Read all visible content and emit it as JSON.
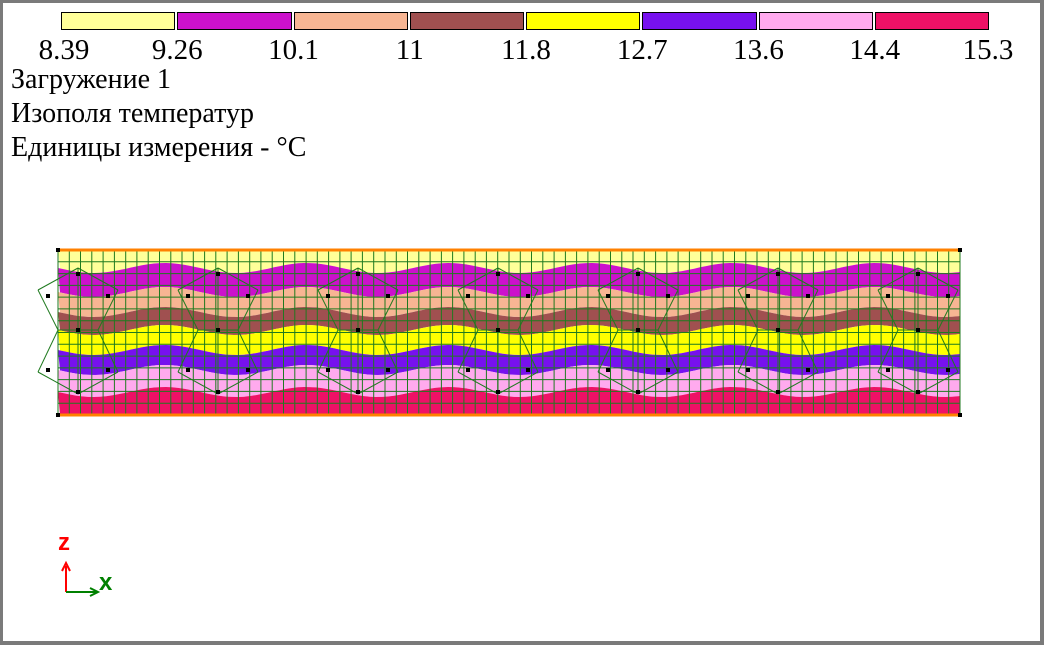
{
  "chart_data": {
    "type": "heatmap",
    "legend": {
      "colors": [
        "#ffff99",
        "#cc11cc",
        "#f7b593",
        "#a05050",
        "#ffff00",
        "#7711ee",
        "#ffaaee",
        "#ee1166"
      ],
      "ticks": [
        "8.39",
        "9.26",
        "10.1",
        "11",
        "11.8",
        "12.7",
        "13.6",
        "14.4",
        "15.3"
      ]
    },
    "info": {
      "load_case": "Загружение 1",
      "result": "Изополя температур",
      "units": "Единицы измерения - °C"
    },
    "bands_top_to_bottom": [
      "#ffff99",
      "#cc11cc",
      "#f7b593",
      "#a05050",
      "#ffff00",
      "#7711ee",
      "#ffaaee",
      "#ee1166"
    ],
    "axes": {
      "vertical": "z",
      "horizontal": "x"
    },
    "colors": {
      "mesh": "#1f7a1f",
      "edge": "#ff8000",
      "node": "#000000",
      "axis_z": "#ff0000",
      "axis_x": "#008000"
    }
  }
}
